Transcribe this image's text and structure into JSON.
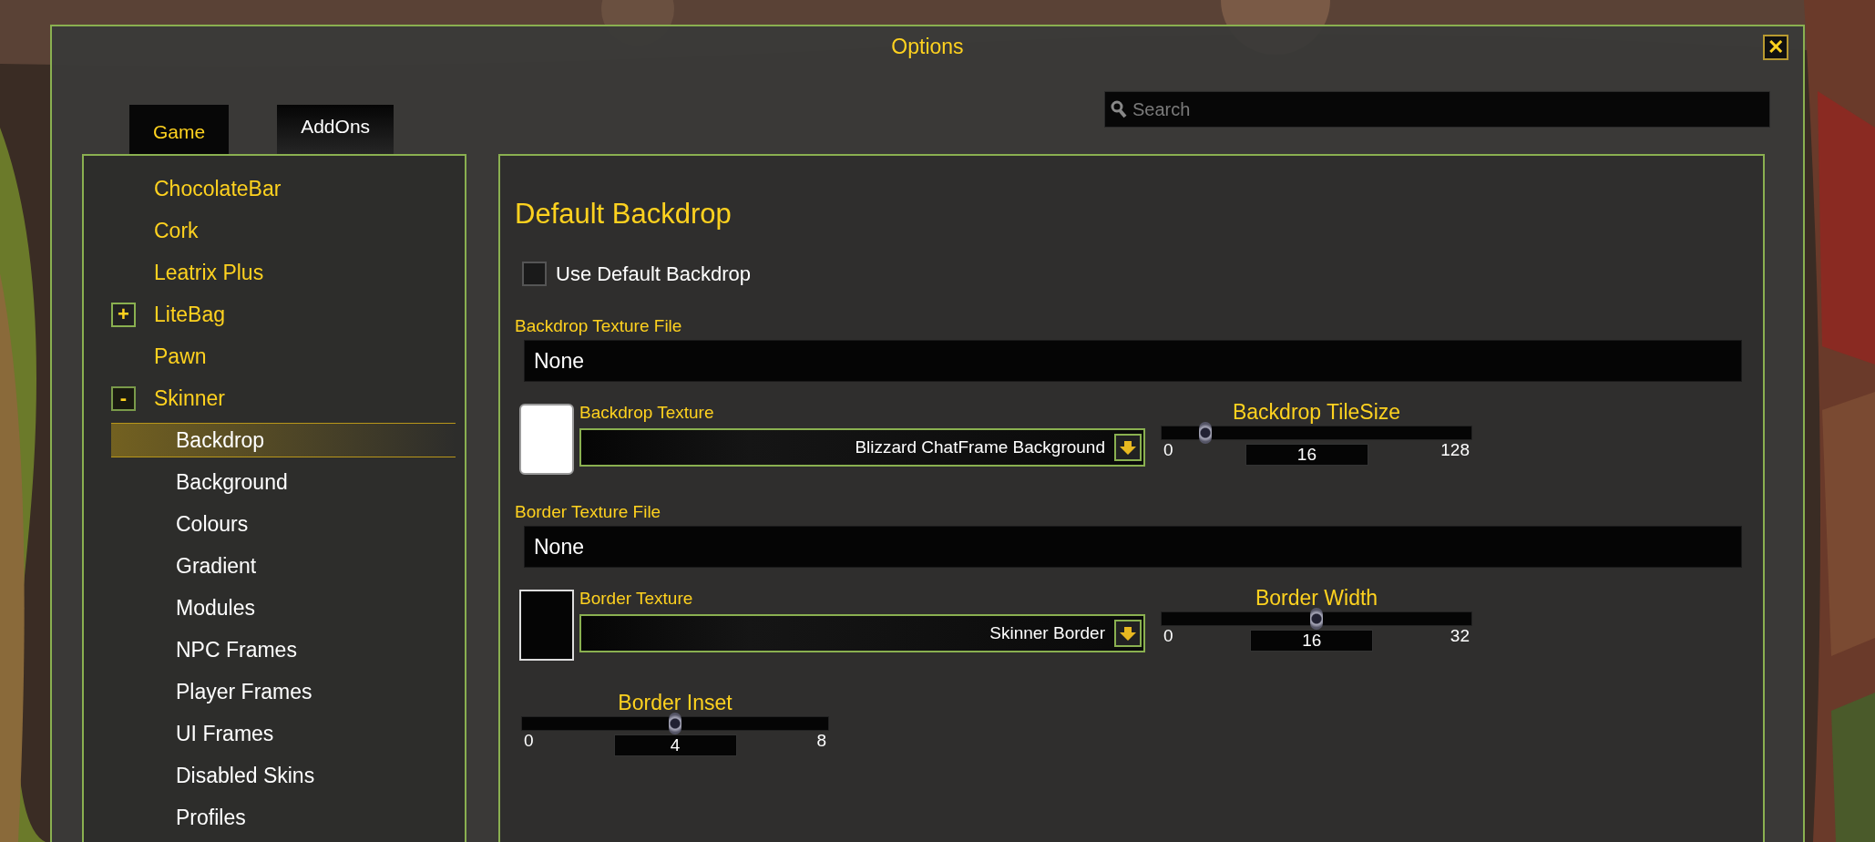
{
  "window": {
    "title": "Options",
    "close_glyph": "✕"
  },
  "tabs": [
    {
      "label": "Game",
      "selected": true
    },
    {
      "label": "AddOns",
      "selected": false
    }
  ],
  "search": {
    "placeholder": "Search"
  },
  "sidebar": {
    "items": [
      {
        "label": "ChocolateBar",
        "selected": false
      },
      {
        "label": "Cork",
        "selected": false
      },
      {
        "label": "Leatrix Plus",
        "selected": false
      },
      {
        "label": "LiteBag",
        "toggle": "+",
        "expanded": false,
        "selected": false
      },
      {
        "label": "Pawn",
        "selected": false
      },
      {
        "label": "Skinner",
        "toggle": "-",
        "expanded": true,
        "selected": false,
        "children": [
          {
            "label": "Backdrop",
            "selected": true
          },
          {
            "label": "Background",
            "selected": false
          },
          {
            "label": "Colours",
            "selected": false
          },
          {
            "label": "Gradient",
            "selected": false
          },
          {
            "label": "Modules",
            "selected": false
          },
          {
            "label": "NPC Frames",
            "selected": false
          },
          {
            "label": "Player Frames",
            "selected": false
          },
          {
            "label": "UI Frames",
            "selected": false
          },
          {
            "label": "Disabled Skins",
            "selected": false
          },
          {
            "label": "Profiles",
            "selected": false
          }
        ]
      }
    ]
  },
  "panel": {
    "heading": "Default Backdrop",
    "use_default_backdrop": {
      "label": "Use Default Backdrop",
      "checked": false
    },
    "texture_groups": [
      {
        "file_label": "Backdrop Texture File",
        "file_value": "None",
        "texture_label": "Backdrop Texture",
        "texture_value": "Blizzard ChatFrame Background",
        "color": "#ffffff",
        "slider": {
          "label": "Backdrop TileSize",
          "min": "0",
          "max": "128",
          "value": "16",
          "level": 0.125
        }
      },
      {
        "file_label": "Border Texture File",
        "file_value": "None",
        "texture_label": "Border Texture",
        "texture_value": "Skinner Border",
        "color": "#050505",
        "slider": {
          "label": "Border Width",
          "min": "0",
          "max": "32",
          "value": "16",
          "level": 0.5
        }
      }
    ],
    "border_inset": {
      "label": "Border Inset",
      "min": "0",
      "max": "8",
      "value": "4",
      "level": 0.5
    }
  }
}
